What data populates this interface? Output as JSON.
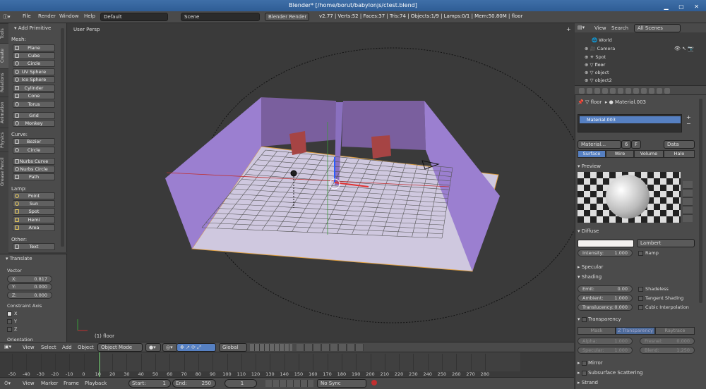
{
  "window": {
    "title": "Blender* [/home/borut/babylonjs/ctest.blend]"
  },
  "topbar": {
    "menus": [
      "File",
      "Render",
      "Window",
      "Help"
    ],
    "layout": "Default",
    "scene": "Scene",
    "engine": "Blender Render",
    "stats": "v2.77 | Verts:52 | Faces:37 | Tris:74 | Objects:1/9 | Lamps:0/1 | Mem:50.80M | floor"
  },
  "toolshelf": {
    "tabs": [
      "Tools",
      "Create",
      "Relations",
      "Animation",
      "Physics",
      "Grease Pencil"
    ],
    "panel_title": "Add Primitive",
    "mesh_label": "Mesh:",
    "mesh": [
      "Plane",
      "Cube",
      "Circle",
      "UV Sphere",
      "Ico Sphere",
      "Cylinder",
      "Cone",
      "Torus"
    ],
    "mesh2": [
      "Grid",
      "Monkey"
    ],
    "curve_label": "Curve:",
    "curve": [
      "Bezier",
      "Circle"
    ],
    "curve2": [
      "Nurbs Curve",
      "Nurbs Circle",
      "Path"
    ],
    "lamp_label": "Lamp:",
    "lamp": [
      "Point",
      "Sun",
      "Spot",
      "Hemi",
      "Area"
    ],
    "other_label": "Other:",
    "other": [
      "Text"
    ]
  },
  "operator": {
    "title": "Translate",
    "vector_label": "Vector",
    "x": {
      "k": "X:",
      "v": "0.817"
    },
    "y": {
      "k": "Y:",
      "v": "0.000"
    },
    "z": {
      "k": "Z:",
      "v": "0.000"
    },
    "constraint_label": "Constraint Axis",
    "axes": [
      "X",
      "Y",
      "Z"
    ],
    "orientation_label": "Orientation"
  },
  "viewport": {
    "view_name": "User Persp",
    "object_label": "(1) floor"
  },
  "vpheader": {
    "menus": [
      "View",
      "Select",
      "Add",
      "Object"
    ],
    "mode": "Object Mode",
    "orientation": "Global"
  },
  "timeline": {
    "ticks": [
      "-50",
      "-40",
      "-30",
      "-20",
      "-10",
      "0",
      "10",
      "20",
      "30",
      "40",
      "50",
      "60",
      "70",
      "80",
      "90",
      "100",
      "110",
      "120",
      "130",
      "140",
      "150",
      "160",
      "170",
      "180",
      "190",
      "200",
      "210",
      "220",
      "230",
      "240",
      "250",
      "260",
      "270",
      "280"
    ],
    "menus": [
      "View",
      "Marker",
      "Frame",
      "Playback"
    ],
    "start": "Start:",
    "start_val": "1",
    "end": "End:",
    "end_val": "250",
    "current": "1",
    "sync": "No Sync"
  },
  "outliner": {
    "menus": [
      "View",
      "Search"
    ],
    "filter": "All Scenes",
    "items": [
      "World",
      "Camera",
      "Spot",
      "floor",
      "object",
      "object2"
    ]
  },
  "properties": {
    "breadcrumb_obj": "floor",
    "breadcrumb_mat": "Material.003",
    "slot": "Material.003",
    "mat_name": "Material...",
    "mat_users": "6",
    "mat_f": "F",
    "data_dropdown": "Data",
    "tabs": [
      "Surface",
      "Wire",
      "Volume",
      "Halo"
    ],
    "preview_title": "Preview",
    "diffuse_title": "Diffuse",
    "diffuse_shader": "Lambert",
    "intensity_label": "Intensity:",
    "intensity_val": "1.000",
    "ramp": "Ramp",
    "specular_title": "Specular",
    "shading_title": "Shading",
    "emit_label": "Emit:",
    "emit_val": "0.00",
    "shadeless": "Shadeless",
    "ambient_label": "Ambient:",
    "ambient_val": "1.000",
    "tangent": "Tangent Shading",
    "translucency_label": "Translucency:",
    "translucency_val": "0.000",
    "cubic": "Cubic Interpolation",
    "transparency_title": "Transparency",
    "trans_tabs": [
      "Mask",
      "Z Transparency",
      "Raytrace"
    ],
    "alpha_label": "Alpha:",
    "alpha_val": "1.000",
    "fresnel_label": "Fresnel:",
    "fresnel_val": "0.000",
    "specular_label": "Specular:",
    "specular_val": "1.000",
    "blend_label": "Blend:",
    "blend_val": "1.250",
    "mirror_title": "Mirror",
    "sss_title": "Subsurface Scattering",
    "strand_title": "Strand"
  },
  "colors": {
    "accent": "#5680c2",
    "wall": "#9b7fd0",
    "floor": "#cfc8df",
    "cube": "#a64444"
  }
}
